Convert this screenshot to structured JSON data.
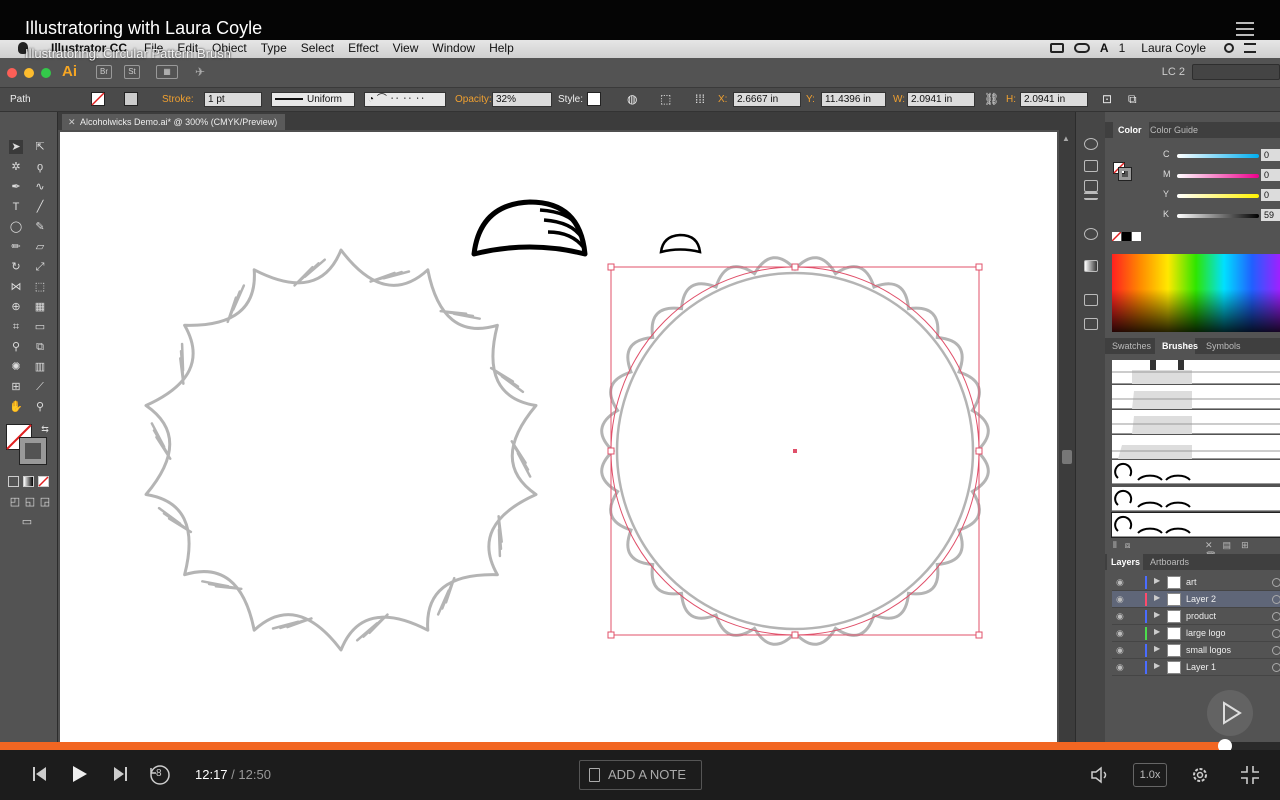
{
  "video": {
    "course_title": "Illustratoring with Laura Coyle",
    "clip_title": "Illustratoring: Circular Pattern Brush"
  },
  "menubar": {
    "app_name": "Illustrator CC",
    "items": [
      "File",
      "Edit",
      "Object",
      "Type",
      "Select",
      "Effect",
      "View",
      "Window",
      "Help"
    ],
    "user": "Laura Coyle",
    "notifications": "1"
  },
  "appbar": {
    "logo": "Ai",
    "bridge": "Br",
    "stock": "St",
    "workspace": "LC 2"
  },
  "controlbar": {
    "selection_type": "Path",
    "stroke_label": "Stroke:",
    "stroke_weight": "1 pt",
    "profile": "Uniform",
    "opacity_label": "Opacity:",
    "opacity_value": "32%",
    "style_label": "Style:",
    "x_label": "X:",
    "x_value": "2.6667 in",
    "y_label": "Y:",
    "y_value": "11.4396 in",
    "w_label": "W:",
    "w_value": "2.0941 in",
    "h_label": "H:",
    "h_value": "2.0941 in"
  },
  "document": {
    "tab_title": "Alcoholwicks Demo.ai* @ 300% (CMYK/Preview)"
  },
  "color_panel": {
    "tabs": [
      "Color",
      "Color Guide"
    ],
    "channels": [
      {
        "label": "C",
        "value": "0"
      },
      {
        "label": "M",
        "value": "0"
      },
      {
        "label": "Y",
        "value": "0"
      },
      {
        "label": "K",
        "value": "59"
      }
    ]
  },
  "brushes_panel": {
    "tabs": [
      "Swatches",
      "Brushes",
      "Symbols"
    ]
  },
  "layers_panel": {
    "tabs": [
      "Layers",
      "Artboards"
    ],
    "layers": [
      {
        "name": "art",
        "color": "#4a6cff"
      },
      {
        "name": "Layer 2",
        "color": "#ff4a6c"
      },
      {
        "name": "product",
        "color": "#4a6cff"
      },
      {
        "name": "large logo",
        "color": "#4cdc4c"
      },
      {
        "name": "small logos",
        "color": "#4a6cff"
      },
      {
        "name": "Layer 1",
        "color": "#4a6cff"
      }
    ]
  },
  "player": {
    "current_time": "12:17",
    "separator": " / ",
    "duration": "12:50",
    "progress": 0.957,
    "skip_seconds": "8",
    "add_note": "ADD A NOTE",
    "speed": "1.0x"
  },
  "colors": {
    "accent": "#f26622",
    "selection": "#e0506a",
    "art_stroke": "#b4b4b4"
  }
}
